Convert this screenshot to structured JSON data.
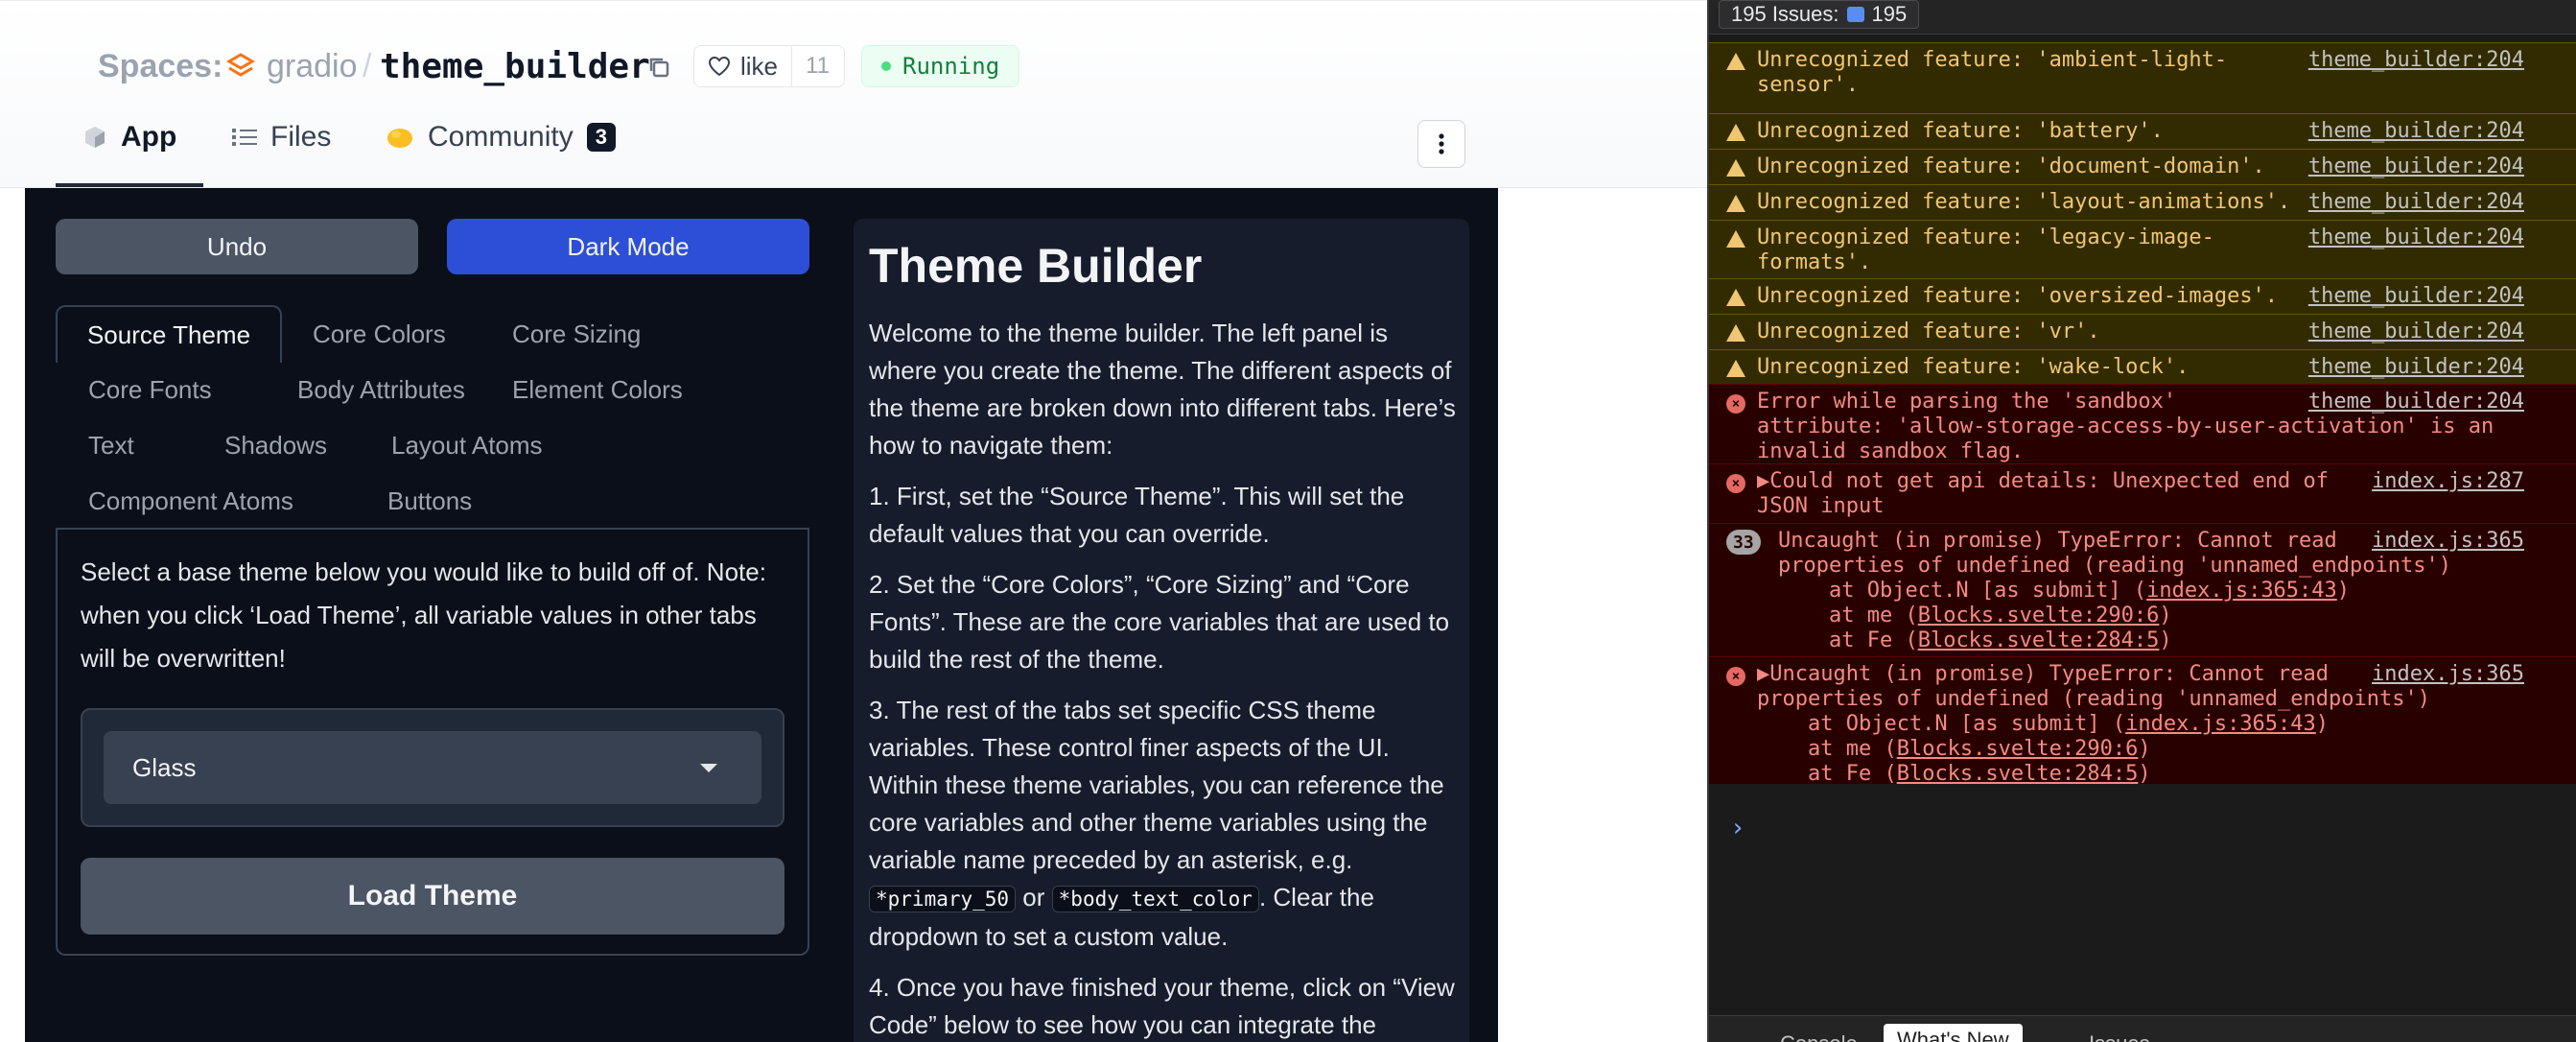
{
  "hf_header": {
    "spaces_label": "Spaces:",
    "org_name": "gradio",
    "separator": "/",
    "repo_name": "theme_builder",
    "like_label": "like",
    "like_count": "11",
    "status": "Running",
    "tabs": [
      {
        "label": "App"
      },
      {
        "label": "Files"
      },
      {
        "label": "Community",
        "badge": "3"
      }
    ]
  },
  "app": {
    "undo_label": "Undo",
    "dark_mode_label": "Dark Mode",
    "tabs": [
      "Source Theme",
      "Core Colors",
      "Core Sizing",
      "Core Fonts",
      "Body Attributes",
      "Element Colors",
      "Text",
      "Shadows",
      "Layout Atoms",
      "Component Atoms",
      "Buttons"
    ],
    "source_description": "Select a base theme below you would like to build off of. Note: when you click ‘Load Theme’, all variable values in other tabs will be overwritten!",
    "dropdown_value": "Glass",
    "load_theme_label": "Load Theme"
  },
  "doc": {
    "title": "Theme Builder",
    "intro": "Welcome to the theme builder. The left panel is where you create the theme. The different aspects of the theme are broken down into different tabs. Here’s how to navigate them:",
    "step1": "1. First, set the “Source Theme”. This will set the default values that you can override.",
    "step2": "2. Set the “Core Colors”, “Core Sizing” and “Core Fonts”. These are the core variables that are used to build the rest of the theme.",
    "step3_a": "3. The rest of the tabs set specific CSS theme variables. These control finer aspects of the UI. Within these theme variables, you can reference the core variables and other theme variables using the variable name preceded by an asterisk, e.g. ",
    "code1": "*primary_50",
    "step3_or": " or ",
    "code2": "*body_text_color",
    "step3_b": ". Clear the dropdown to set a custom value.",
    "step4": "4. Once you have finished your theme, click on “View Code” below to see how you can integrate the"
  },
  "devtools": {
    "issues_label": "195 Issues:",
    "issues_count": "195",
    "rows": [
      {
        "type": "warn",
        "msg": "Unrecognized feature: 'ambient-light-\nsensor'.",
        "src": "theme_builder:204"
      },
      {
        "type": "warn",
        "msg": "Unrecognized feature: 'battery'.",
        "src": "theme_builder:204"
      },
      {
        "type": "warn",
        "msg": "Unrecognized feature: 'document-domain'.",
        "src": "theme_builder:204"
      },
      {
        "type": "warn",
        "msg": "Unrecognized feature: 'layout-animations'.",
        "src": "theme_builder:204"
      },
      {
        "type": "warn",
        "msg": "Unrecognized feature: 'legacy-image-\nformats'.",
        "src": "theme_builder:204"
      },
      {
        "type": "warn",
        "msg": "Unrecognized feature: 'oversized-images'.",
        "src": "theme_builder:204"
      },
      {
        "type": "warn",
        "msg": "Unrecognized feature: 'vr'.",
        "src": "theme_builder:204"
      },
      {
        "type": "warn",
        "msg": "Unrecognized feature: 'wake-lock'.",
        "src": "theme_builder:204"
      },
      {
        "type": "err",
        "msg": "Error while parsing the 'sandbox'\nattribute: 'allow-storage-access-by-user-activation' is an\ninvalid sandbox flag.",
        "src": "theme_builder:204"
      },
      {
        "type": "err",
        "msg": "▶Could not get api details: Unexpected end of\nJSON input",
        "src": "index.js:287"
      },
      {
        "type": "err",
        "count": "33",
        "msg": "Uncaught (in promise) TypeError: Cannot read\nproperties of undefined (reading 'unnamed_endpoints')",
        "src": "index.js:365",
        "stack": [
          {
            "pre": "    at Object.N [as submit] (",
            "link": "index.js:365:43",
            "post": ")"
          },
          {
            "pre": "    at me (",
            "link": "Blocks.svelte:290:6",
            "post": ")"
          },
          {
            "pre": "    at Fe (",
            "link": "Blocks.svelte:284:5",
            "post": ")"
          }
        ]
      },
      {
        "type": "err",
        "msg": "▶Uncaught (in promise) TypeError: Cannot read\nproperties of undefined (reading 'unnamed_endpoints')",
        "src": "index.js:365",
        "stack": [
          {
            "pre": "    at Object.N [as submit] (",
            "link": "index.js:365:43",
            "post": ")"
          },
          {
            "pre": "    at me (",
            "link": "Blocks.svelte:290:6",
            "post": ")"
          },
          {
            "pre": "    at Fe (",
            "link": "Blocks.svelte:284:5",
            "post": ")"
          }
        ]
      }
    ],
    "prompt": "›",
    "drawer_tabs": [
      "Console",
      "What's New",
      "Issues"
    ]
  },
  "colors": {
    "accent_blue": "#2d4fd8",
    "app_bg": "#0b0f19",
    "warn_bg": "#332b00",
    "error_bg": "#290000",
    "running_green": "#15803d"
  },
  "icons": [
    "spaces-logo-icon",
    "gradio-org-icon",
    "copy-icon",
    "heart-icon",
    "app-cube-icon",
    "files-list-icon",
    "community-hand-icon",
    "kebab-menu-icon",
    "warning-icon",
    "error-icon",
    "chevron-down-icon"
  ]
}
